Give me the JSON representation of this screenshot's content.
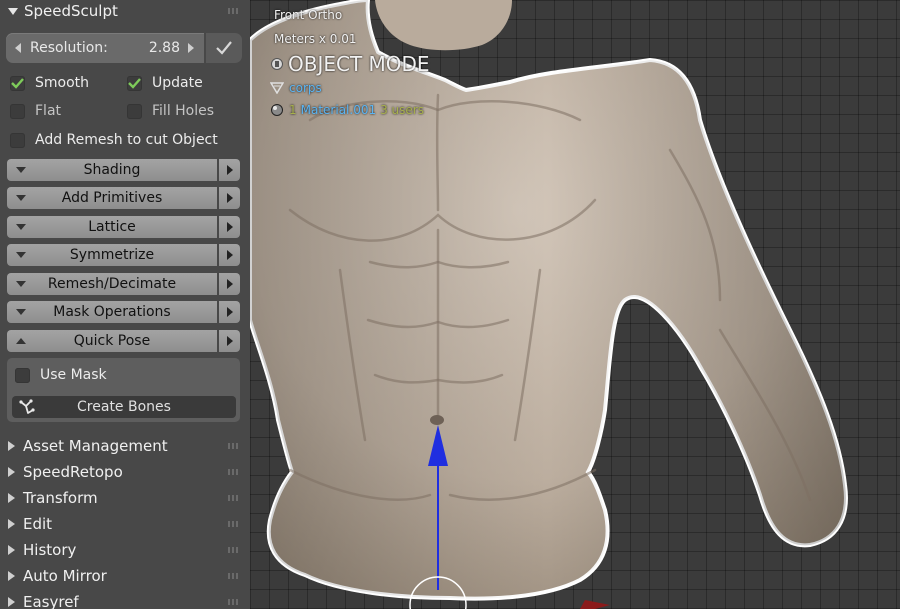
{
  "panel": {
    "title": "SpeedSculpt",
    "resolution": {
      "label": "Resolution:",
      "value": "2.88"
    },
    "checkboxes": [
      {
        "label": "Smooth",
        "checked": true
      },
      {
        "label": "Update",
        "checked": true
      },
      {
        "label": "Flat",
        "checked": false
      },
      {
        "label": "Fill Holes",
        "checked": false
      },
      {
        "label": "Add Remesh to cut Object",
        "checked": false
      }
    ],
    "subpanels": [
      {
        "label": "Shading",
        "expanded": false
      },
      {
        "label": "Add Primitives",
        "expanded": false
      },
      {
        "label": "Lattice",
        "expanded": false
      },
      {
        "label": "Symmetrize",
        "expanded": false
      },
      {
        "label": "Remesh/Decimate",
        "expanded": false
      },
      {
        "label": "Mask Operations",
        "expanded": false
      },
      {
        "label": "Quick Pose",
        "expanded": true
      }
    ],
    "quick_pose": {
      "use_mask": {
        "label": "Use Mask",
        "checked": false
      },
      "create_bones": "Create Bones"
    },
    "collapsed_panels": [
      "Asset Management",
      "SpeedRetopo",
      "Transform",
      "Edit",
      "History",
      "Auto Mirror",
      "Easyref"
    ]
  },
  "viewport": {
    "view_name": "Front Ortho",
    "units": "Meters x 0.01",
    "mode": "OBJECT MODE",
    "object_name": "corps",
    "material": {
      "index": "1",
      "name": "Material.001",
      "users": "3 users"
    }
  },
  "colors": {
    "panel_bg": "#484848",
    "accent_blue": "#5ab4f2",
    "checkmark_green": "#7ecb5a",
    "outline_white": "#ffffff",
    "gizmo_blue": "#1f2ee0",
    "skin": "#c2b4a6"
  },
  "icons": [
    "triangle-down-icon",
    "checkmark-icon",
    "arrow-left-icon",
    "arrow-right-icon",
    "bones-icon",
    "mesh-icon",
    "material-sphere-icon",
    "camera-icon"
  ]
}
